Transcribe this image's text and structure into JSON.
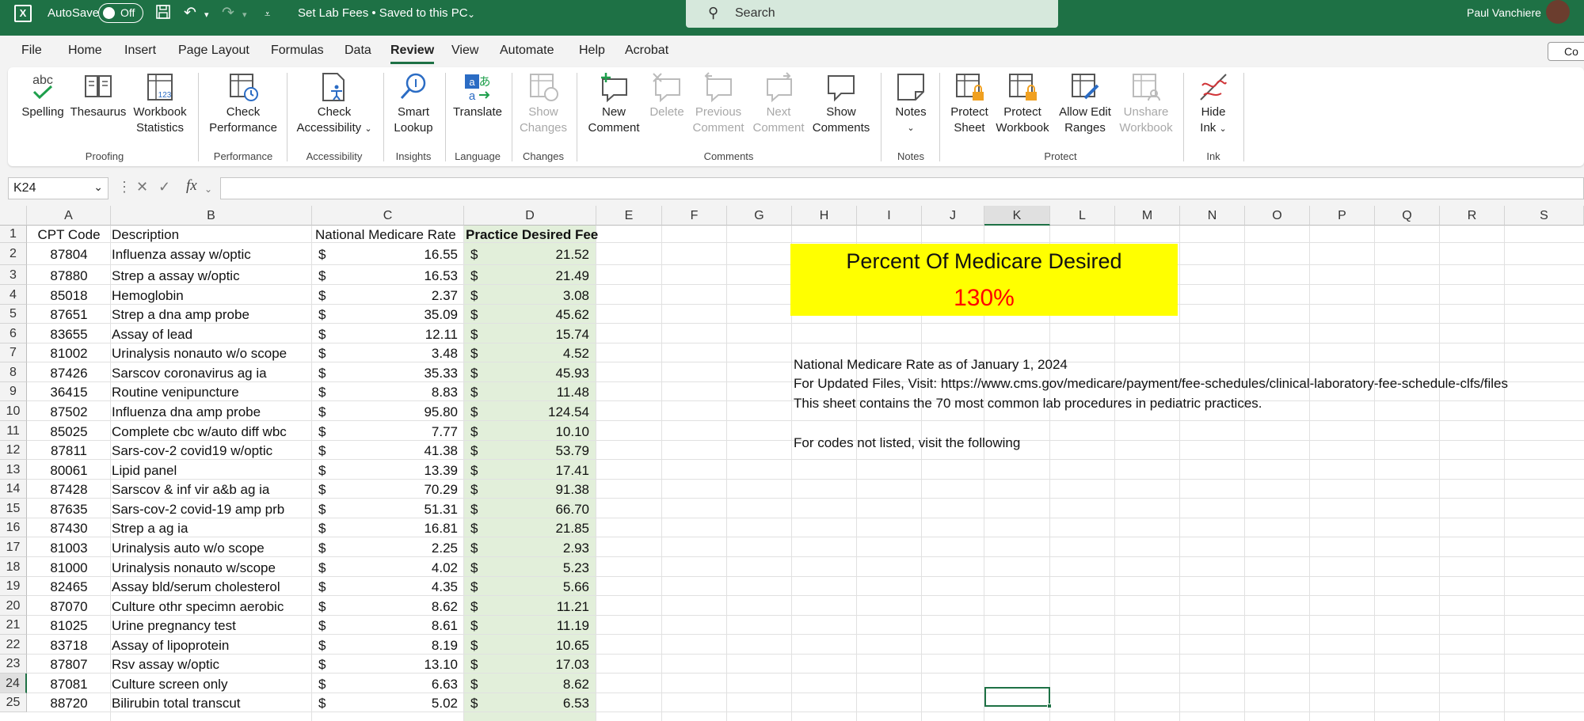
{
  "titlebar": {
    "autosave_label": "AutoSave",
    "autosave_state": "Off",
    "doc_title": "Set Lab Fees • Saved to this PC",
    "search_placeholder": "Search",
    "user_name": "Paul Vanchiere"
  },
  "menu": {
    "items": [
      "File",
      "Home",
      "Insert",
      "Page Layout",
      "Formulas",
      "Data",
      "Review",
      "View",
      "Automate",
      "Help",
      "Acrobat"
    ],
    "active": "Review",
    "comments_label": "Co"
  },
  "ribbon": {
    "spelling": "Spelling",
    "thesaurus": "Thesaurus",
    "workbook_stats": [
      "Workbook",
      "Statistics"
    ],
    "proofing": "Proofing",
    "check_perf": [
      "Check",
      "Performance"
    ],
    "performance": "Performance",
    "check_access": [
      "Check",
      "Accessibility"
    ],
    "accessibility": "Accessibility",
    "smart_lookup": [
      "Smart",
      "Lookup"
    ],
    "insights": "Insights",
    "translate": "Translate",
    "language": "Language",
    "show_changes": [
      "Show",
      "Changes"
    ],
    "changes": "Changes",
    "new_comment": [
      "New",
      "Comment"
    ],
    "delete": "Delete",
    "prev_comment": [
      "Previous",
      "Comment"
    ],
    "next_comment": [
      "Next",
      "Comment"
    ],
    "show_comments": [
      "Show",
      "Comments"
    ],
    "comments": "Comments",
    "notes_btn": "Notes",
    "notes": "Notes",
    "protect_sheet": [
      "Protect",
      "Sheet"
    ],
    "protect_workbook": [
      "Protect",
      "Workbook"
    ],
    "allow_edit": [
      "Allow Edit",
      "Ranges"
    ],
    "unshare": [
      "Unshare",
      "Workbook"
    ],
    "protect": "Protect",
    "hide_ink": [
      "Hide",
      "Ink"
    ],
    "ink": "Ink",
    "spelling_icon_text": "abc"
  },
  "formula_bar": {
    "name_box": "K24",
    "fx": "fx",
    "value": ""
  },
  "sheet": {
    "columns": [
      "A",
      "B",
      "C",
      "D",
      "E",
      "F",
      "G",
      "H",
      "I",
      "J",
      "K",
      "L",
      "M",
      "N",
      "O",
      "P",
      "Q",
      "R",
      "S"
    ],
    "rows": [
      "1",
      "2",
      "3",
      "4",
      "5",
      "6",
      "7",
      "8",
      "9",
      "10",
      "11",
      "12",
      "13",
      "14",
      "15",
      "16",
      "17",
      "18",
      "19",
      "20",
      "21",
      "22",
      "23",
      "24",
      "25"
    ],
    "headers": {
      "cpt": "CPT Code",
      "desc": "Description",
      "rate": "National Medicare Rate",
      "fee": "Practice Desired Fee"
    },
    "currency": "$",
    "data": [
      {
        "cpt": "87804",
        "desc": "Influenza assay w/optic",
        "rate": "16.55",
        "fee": "21.52"
      },
      {
        "cpt": "87880",
        "desc": "Strep a assay w/optic",
        "rate": "16.53",
        "fee": "21.49"
      },
      {
        "cpt": "85018",
        "desc": "Hemoglobin",
        "rate": "2.37",
        "fee": "3.08"
      },
      {
        "cpt": "87651",
        "desc": "Strep a dna amp probe",
        "rate": "35.09",
        "fee": "45.62"
      },
      {
        "cpt": "83655",
        "desc": "Assay of lead",
        "rate": "12.11",
        "fee": "15.74"
      },
      {
        "cpt": "81002",
        "desc": "Urinalysis nonauto w/o scope",
        "rate": "3.48",
        "fee": "4.52"
      },
      {
        "cpt": "87426",
        "desc": "Sarscov coronavirus ag ia",
        "rate": "35.33",
        "fee": "45.93"
      },
      {
        "cpt": "36415",
        "desc": "Routine venipuncture",
        "rate": "8.83",
        "fee": "11.48"
      },
      {
        "cpt": "87502",
        "desc": "Influenza dna amp probe",
        "rate": "95.80",
        "fee": "124.54"
      },
      {
        "cpt": "85025",
        "desc": "Complete cbc w/auto diff wbc",
        "rate": "7.77",
        "fee": "10.10"
      },
      {
        "cpt": "87811",
        "desc": "Sars-cov-2 covid19 w/optic",
        "rate": "41.38",
        "fee": "53.79"
      },
      {
        "cpt": "80061",
        "desc": "Lipid panel",
        "rate": "13.39",
        "fee": "17.41"
      },
      {
        "cpt": "87428",
        "desc": "Sarscov & inf vir a&b ag ia",
        "rate": "70.29",
        "fee": "91.38"
      },
      {
        "cpt": "87635",
        "desc": "Sars-cov-2 covid-19 amp prb",
        "rate": "51.31",
        "fee": "66.70"
      },
      {
        "cpt": "87430",
        "desc": "Strep a ag ia",
        "rate": "16.81",
        "fee": "21.85"
      },
      {
        "cpt": "81003",
        "desc": "Urinalysis auto w/o scope",
        "rate": "2.25",
        "fee": "2.93"
      },
      {
        "cpt": "81000",
        "desc": "Urinalysis nonauto w/scope",
        "rate": "4.02",
        "fee": "5.23"
      },
      {
        "cpt": "82465",
        "desc": "Assay bld/serum cholesterol",
        "rate": "4.35",
        "fee": "5.66"
      },
      {
        "cpt": "87070",
        "desc": "Culture othr specimn aerobic",
        "rate": "8.62",
        "fee": "11.21"
      },
      {
        "cpt": "81025",
        "desc": "Urine pregnancy test",
        "rate": "8.61",
        "fee": "11.19"
      },
      {
        "cpt": "83718",
        "desc": "Assay of lipoprotein",
        "rate": "8.19",
        "fee": "10.65"
      },
      {
        "cpt": "87807",
        "desc": "Rsv assay w/optic",
        "rate": "13.10",
        "fee": "17.03"
      },
      {
        "cpt": "87081",
        "desc": "Culture screen only",
        "rate": "6.63",
        "fee": "8.62"
      },
      {
        "cpt": "88720",
        "desc": "Bilirubin total transcut",
        "rate": "5.02",
        "fee": "6.53"
      }
    ],
    "percent_box": {
      "title": "Percent Of Medicare Desired",
      "value": "130%"
    },
    "notes": [
      "National Medicare Rate as of January 1, 2024",
      "For Updated Files, Visit: https://www.cms.gov/medicare/payment/fee-schedules/clinical-laboratory-fee-schedule-clfs/files",
      "This sheet contains the 70 most common lab procedures in pediatric practices.",
      "For codes not listed, visit the following"
    ],
    "active_cell": "K24"
  },
  "colors": {
    "brand": "#1e7145",
    "fee_fill": "#e2efda",
    "highlight": "#ffff00",
    "percent_text": "#ff0000"
  }
}
